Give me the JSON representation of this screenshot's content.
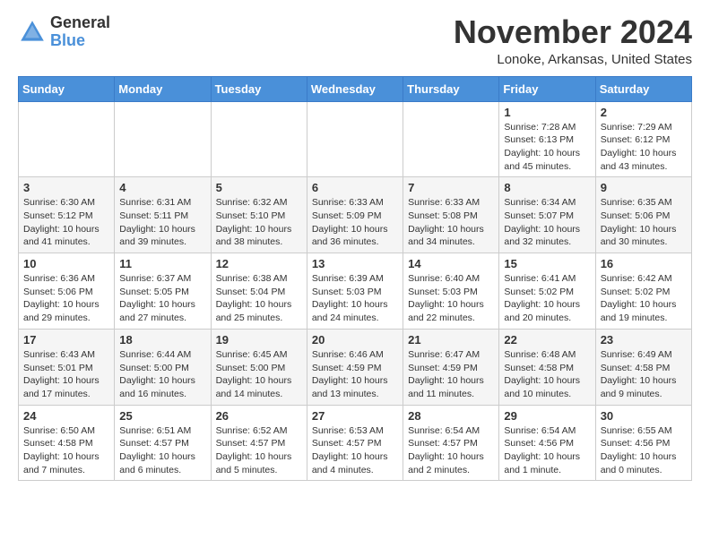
{
  "header": {
    "logo_general": "General",
    "logo_blue": "Blue",
    "month": "November 2024",
    "location": "Lonoke, Arkansas, United States"
  },
  "days_of_week": [
    "Sunday",
    "Monday",
    "Tuesday",
    "Wednesday",
    "Thursday",
    "Friday",
    "Saturday"
  ],
  "weeks": [
    [
      {
        "day": "",
        "info": ""
      },
      {
        "day": "",
        "info": ""
      },
      {
        "day": "",
        "info": ""
      },
      {
        "day": "",
        "info": ""
      },
      {
        "day": "",
        "info": ""
      },
      {
        "day": "1",
        "info": "Sunrise: 7:28 AM\nSunset: 6:13 PM\nDaylight: 10 hours\nand 45 minutes."
      },
      {
        "day": "2",
        "info": "Sunrise: 7:29 AM\nSunset: 6:12 PM\nDaylight: 10 hours\nand 43 minutes."
      }
    ],
    [
      {
        "day": "3",
        "info": "Sunrise: 6:30 AM\nSunset: 5:12 PM\nDaylight: 10 hours\nand 41 minutes."
      },
      {
        "day": "4",
        "info": "Sunrise: 6:31 AM\nSunset: 5:11 PM\nDaylight: 10 hours\nand 39 minutes."
      },
      {
        "day": "5",
        "info": "Sunrise: 6:32 AM\nSunset: 5:10 PM\nDaylight: 10 hours\nand 38 minutes."
      },
      {
        "day": "6",
        "info": "Sunrise: 6:33 AM\nSunset: 5:09 PM\nDaylight: 10 hours\nand 36 minutes."
      },
      {
        "day": "7",
        "info": "Sunrise: 6:33 AM\nSunset: 5:08 PM\nDaylight: 10 hours\nand 34 minutes."
      },
      {
        "day": "8",
        "info": "Sunrise: 6:34 AM\nSunset: 5:07 PM\nDaylight: 10 hours\nand 32 minutes."
      },
      {
        "day": "9",
        "info": "Sunrise: 6:35 AM\nSunset: 5:06 PM\nDaylight: 10 hours\nand 30 minutes."
      }
    ],
    [
      {
        "day": "10",
        "info": "Sunrise: 6:36 AM\nSunset: 5:06 PM\nDaylight: 10 hours\nand 29 minutes."
      },
      {
        "day": "11",
        "info": "Sunrise: 6:37 AM\nSunset: 5:05 PM\nDaylight: 10 hours\nand 27 minutes."
      },
      {
        "day": "12",
        "info": "Sunrise: 6:38 AM\nSunset: 5:04 PM\nDaylight: 10 hours\nand 25 minutes."
      },
      {
        "day": "13",
        "info": "Sunrise: 6:39 AM\nSunset: 5:03 PM\nDaylight: 10 hours\nand 24 minutes."
      },
      {
        "day": "14",
        "info": "Sunrise: 6:40 AM\nSunset: 5:03 PM\nDaylight: 10 hours\nand 22 minutes."
      },
      {
        "day": "15",
        "info": "Sunrise: 6:41 AM\nSunset: 5:02 PM\nDaylight: 10 hours\nand 20 minutes."
      },
      {
        "day": "16",
        "info": "Sunrise: 6:42 AM\nSunset: 5:02 PM\nDaylight: 10 hours\nand 19 minutes."
      }
    ],
    [
      {
        "day": "17",
        "info": "Sunrise: 6:43 AM\nSunset: 5:01 PM\nDaylight: 10 hours\nand 17 minutes."
      },
      {
        "day": "18",
        "info": "Sunrise: 6:44 AM\nSunset: 5:00 PM\nDaylight: 10 hours\nand 16 minutes."
      },
      {
        "day": "19",
        "info": "Sunrise: 6:45 AM\nSunset: 5:00 PM\nDaylight: 10 hours\nand 14 minutes."
      },
      {
        "day": "20",
        "info": "Sunrise: 6:46 AM\nSunset: 4:59 PM\nDaylight: 10 hours\nand 13 minutes."
      },
      {
        "day": "21",
        "info": "Sunrise: 6:47 AM\nSunset: 4:59 PM\nDaylight: 10 hours\nand 11 minutes."
      },
      {
        "day": "22",
        "info": "Sunrise: 6:48 AM\nSunset: 4:58 PM\nDaylight: 10 hours\nand 10 minutes."
      },
      {
        "day": "23",
        "info": "Sunrise: 6:49 AM\nSunset: 4:58 PM\nDaylight: 10 hours\nand 9 minutes."
      }
    ],
    [
      {
        "day": "24",
        "info": "Sunrise: 6:50 AM\nSunset: 4:58 PM\nDaylight: 10 hours\nand 7 minutes."
      },
      {
        "day": "25",
        "info": "Sunrise: 6:51 AM\nSunset: 4:57 PM\nDaylight: 10 hours\nand 6 minutes."
      },
      {
        "day": "26",
        "info": "Sunrise: 6:52 AM\nSunset: 4:57 PM\nDaylight: 10 hours\nand 5 minutes."
      },
      {
        "day": "27",
        "info": "Sunrise: 6:53 AM\nSunset: 4:57 PM\nDaylight: 10 hours\nand 4 minutes."
      },
      {
        "day": "28",
        "info": "Sunrise: 6:54 AM\nSunset: 4:57 PM\nDaylight: 10 hours\nand 2 minutes."
      },
      {
        "day": "29",
        "info": "Sunrise: 6:54 AM\nSunset: 4:56 PM\nDaylight: 10 hours\nand 1 minute."
      },
      {
        "day": "30",
        "info": "Sunrise: 6:55 AM\nSunset: 4:56 PM\nDaylight: 10 hours\nand 0 minutes."
      }
    ]
  ]
}
